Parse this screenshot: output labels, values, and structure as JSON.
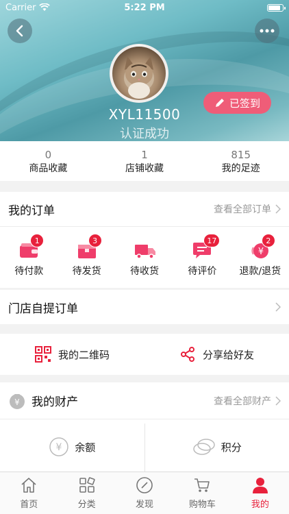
{
  "status_bar": {
    "carrier": "Carrier",
    "time": "5:22 PM"
  },
  "header": {
    "user_name": "XYL11500",
    "user_status": "认证成功",
    "signin_label": "已签到",
    "back_icon": "back-chevron-icon",
    "more_icon": "more-dots-icon"
  },
  "stats": [
    {
      "count": "0",
      "label": "商品收藏"
    },
    {
      "count": "1",
      "label": "店铺收藏"
    },
    {
      "count": "815",
      "label": "我的足迹"
    }
  ],
  "orders": {
    "title": "我的订单",
    "more_label": "查看全部订单",
    "items": [
      {
        "label": "待付款",
        "badge": "1",
        "icon": "wallet-icon"
      },
      {
        "label": "待发货",
        "badge": "3",
        "icon": "package-icon"
      },
      {
        "label": "待收货",
        "badge": "",
        "icon": "truck-icon"
      },
      {
        "label": "待评价",
        "badge": "17",
        "icon": "comment-icon"
      },
      {
        "label": "退款/退货",
        "badge": "2",
        "icon": "refund-icon"
      }
    ]
  },
  "store_pickup": {
    "title": "门店自提订单"
  },
  "share": {
    "qrcode_label": "我的二维码",
    "share_label": "分享给好友"
  },
  "wealth": {
    "title": "我的财产",
    "more_label": "查看全部财产",
    "balance_label": "余额",
    "points_label": "积分"
  },
  "tabbar": {
    "items": [
      {
        "label": "首页",
        "icon": "home-icon"
      },
      {
        "label": "分类",
        "icon": "category-icon"
      },
      {
        "label": "发现",
        "icon": "compass-icon"
      },
      {
        "label": "购物车",
        "icon": "cart-icon"
      },
      {
        "label": "我的",
        "icon": "user-icon",
        "active": true
      }
    ]
  },
  "colors": {
    "accent": "#e8213c",
    "pink": "#ef5d78",
    "teal": "#6fbcc6"
  }
}
